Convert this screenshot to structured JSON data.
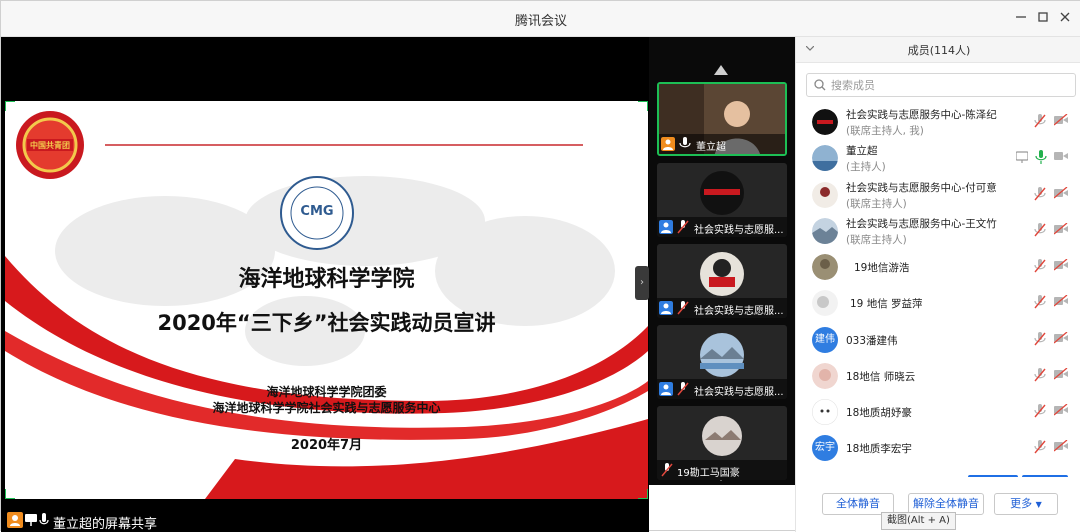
{
  "window": {
    "title": "腾讯会议"
  },
  "slide": {
    "college": "海洋地球科学学院",
    "headline": "2020年“三下乡”社会实践动员宣讲",
    "org1": "海洋地球科学学院团委",
    "org2": "海洋地球科学学院社会实践与志愿服务中心",
    "date": "2020年7月",
    "logo_text": "CMG",
    "emblem_text": "中国共青团"
  },
  "share_bar": {
    "label": "董立超的屏幕共享"
  },
  "video_tiles": [
    {
      "name": "董立超"
    },
    {
      "name": "社会实践与志愿服..."
    },
    {
      "name": "社会实践与志愿服..."
    },
    {
      "name": "社会实践与志愿服..."
    },
    {
      "name": "19勘工马国豪"
    }
  ],
  "panel": {
    "title": "成员(114人)",
    "search_placeholder": "搜索成员",
    "members": [
      {
        "name": "社会实践与志愿服务中心-陈泽纪",
        "role": "(联席主持人, 我)",
        "mic": "muted",
        "cam": "off"
      },
      {
        "name": "董立超",
        "role": "(主持人)",
        "mic": "on",
        "cam": "off",
        "sharing": true
      },
      {
        "name": "社会实践与志愿服务中心-付可意",
        "role": "(联席主持人)",
        "mic": "muted",
        "cam": "off"
      },
      {
        "name": "社会实践与志愿服务中心-王文竹",
        "role": "(联席主持人)",
        "mic": "muted",
        "cam": "off"
      },
      {
        "name": "19地信游浩",
        "role": "",
        "mic": "muted",
        "cam": "off"
      },
      {
        "name": "19 地信 罗益萍",
        "role": "",
        "mic": "muted",
        "cam": "off"
      },
      {
        "name": "033潘建伟",
        "role": "",
        "mic": "muted",
        "cam": "off",
        "avatar_text": "建伟"
      },
      {
        "name": "18地信 师晓云",
        "role": "",
        "mic": "muted",
        "cam": "off"
      },
      {
        "name": "18地质胡妤豪",
        "role": "",
        "mic": "muted",
        "cam": "off"
      },
      {
        "name": "18地质李宏宇",
        "role": "",
        "mic": "muted",
        "cam": "off",
        "avatar_text": "宏宇"
      }
    ],
    "buttons": {
      "mute_all": "全体静音",
      "unmute_all": "解除全体静音",
      "more": "更多"
    }
  },
  "tooltip": "截图(Alt + A)",
  "colors": {
    "accent": "#1f6fe5",
    "mic_on": "#22b14c",
    "muted": "#e0473c",
    "slide_red": "#d7191c"
  }
}
